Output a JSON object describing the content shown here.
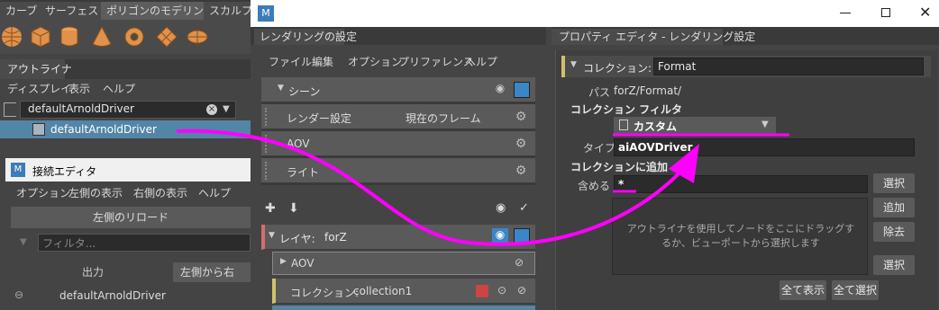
{
  "maya": {
    "shelf_tabs": [
      "カーブ",
      "サーフェス",
      "ポリゴンのモデリング",
      "スカルプト"
    ],
    "shelf_icons": [
      "sphere-icon",
      "cube-icon",
      "cylinder-icon",
      "cone-icon",
      "torus-icon",
      "plane-icon",
      "disc-icon"
    ]
  },
  "outliner": {
    "tab_label": "アウトライナ",
    "menu": [
      "ディスプレイ",
      "表示",
      "ヘルプ"
    ],
    "search_value": "defaultArnoldDriver",
    "item_label": "defaultArnoldDriver"
  },
  "connection_editor": {
    "title": "接続エディタ",
    "menu": [
      "オプション",
      "左側の表示",
      "右側の表示",
      "ヘルプ"
    ],
    "reload_left": "左側のリロード",
    "filter_placeholder": "フィルタ...",
    "outputs_tab": "出力",
    "left_tab": "左側から右",
    "row_label": "defaultArnoldDriver"
  },
  "render_settings": {
    "window_logo": "M",
    "header_tab": "レンダリングの設定",
    "menu": [
      "ファイル",
      "編集",
      "オプション",
      "プリファレンス",
      "ヘルプ"
    ],
    "scene_label": "シーン",
    "render_settings_label": "レンダー設定",
    "current_frame_label": "現在のフレーム",
    "aov_label": "AOV",
    "lights_label": "ライト",
    "layer_label": "レイヤ:",
    "layer_name": "forZ",
    "layer_aov_label": "AOV",
    "collection_label": "コレクション:",
    "collection_name": "collection1"
  },
  "property_editor": {
    "header_tab": "プロパティ エディタ - レンダリング設定",
    "collection_label": "コレクション:",
    "collection_value": "Format",
    "path_label": "パス",
    "path_value": "forZ/Format/",
    "filter_section_label": "コレクション フィルタ",
    "filter_dropdown_value": "カスタム",
    "type_label": "タイプ",
    "type_value": "aiAOVDriver",
    "add_section_label": "コレクションに追加",
    "include_label": "含める",
    "include_value": "*",
    "select_button": "選択",
    "add_button": "追加",
    "remove_button": "除去",
    "select_button_2": "選択",
    "dropzone_text": "アウトライナを使用してノードをここにドラッグするか、ビューポートから選択します",
    "show_all_button": "全て表示",
    "select_all_button": "全て選択"
  },
  "window_controls": [
    "minimize",
    "maximize",
    "close"
  ],
  "colors": {
    "accent_blue": "#5285a6",
    "annotation_magenta": "#ff00ff",
    "layer_accent": "#d46e6e",
    "collection_accent": "#cfc168"
  }
}
